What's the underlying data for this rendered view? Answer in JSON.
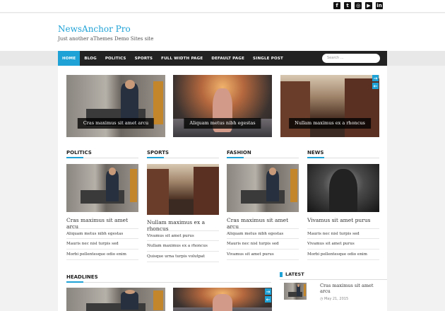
{
  "social": {
    "icons": [
      "facebook-icon",
      "twitter-icon",
      "instagram-icon",
      "youtube-icon",
      "linkedin-icon"
    ],
    "glyphs": [
      "f",
      "t",
      "◎",
      "▶",
      "in"
    ]
  },
  "site": {
    "title": "NewsAnchor Pro",
    "tagline": "Just another aThemes Demo Sites site"
  },
  "nav": {
    "items": [
      "HOME",
      "BLOG",
      "POLITICS",
      "SPORTS",
      "FULL WIDTH PAGE",
      "DEFAULT PAGE",
      "SINGLE POST"
    ],
    "active": "HOME",
    "search_placeholder": "Search ..."
  },
  "colors": {
    "accent": "#1fa2d6",
    "nav_bg": "#222222"
  },
  "slider": {
    "slides": [
      {
        "caption": "Cras maximus sit amet arcu",
        "image": "man-on-couch"
      },
      {
        "caption": "Aliquam metus nibh egestas",
        "image": "girl-on-road"
      },
      {
        "caption": "Nullam maximus ex a rhoncus",
        "image": "city-canal"
      }
    ],
    "arrows": [
      "→",
      "←"
    ]
  },
  "sections": [
    {
      "title": "POLITICS",
      "featured": "Cras maximus sit amet arcu",
      "items": [
        "Aliquam metus nibh egestas",
        "Mauris nec nisl turpis sed",
        "Morbi pellentesque odio enim"
      ]
    },
    {
      "title": "SPORTS",
      "featured": "Nullam maximus ex a rhoncus",
      "items": [
        "Vivamus sit amet purus",
        "Nullam maximus ex a rhoncus",
        "Quisque urna turpis volutpat"
      ]
    },
    {
      "title": "FASHION",
      "featured": "Cras maximus sit amet arcu",
      "items": [
        "Aliquam metus nibh egestas",
        "Mauris nec nisl turpis sed",
        "Vivamus sit amet purus"
      ]
    },
    {
      "title": "NEWS",
      "featured": "Vivamus sit amet purus",
      "items": [
        "Mauris nec nisl turpis sed",
        "Vivamus sit amet purus",
        "Morbi pellentesque odio enim"
      ]
    }
  ],
  "headlines": {
    "title": "HEADLINES"
  },
  "latest": {
    "title": "LATEST",
    "post_title": "Cras maximus sit amet arcu",
    "date": "May 21, 2015"
  }
}
